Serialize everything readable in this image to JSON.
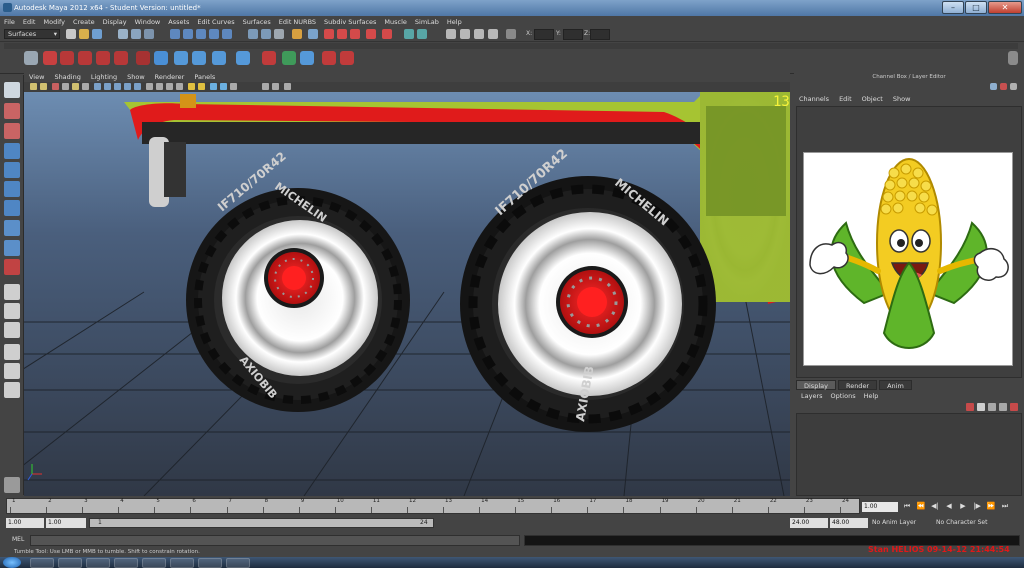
{
  "window": {
    "title": "Autodesk Maya 2012 x64 - Student Version: untitled*",
    "minimize": "–",
    "maximize": "□",
    "close": "✕"
  },
  "menubar": [
    "File",
    "Edit",
    "Modify",
    "Create",
    "Display",
    "Window",
    "Assets",
    "Edit Curves",
    "Surfaces",
    "Edit NURBS",
    "Subdiv Surfaces",
    "Muscle",
    "SimLab",
    "Help"
  ],
  "statusline": {
    "mode": "Surfaces",
    "x_label": "X:",
    "y_label": "Y:",
    "z_label": "Z:"
  },
  "viewport": {
    "menu": [
      "View",
      "Shading",
      "Lighting",
      "Show",
      "Renderer",
      "Panels"
    ],
    "frame_counter": "13"
  },
  "channel_box": {
    "header": "Channel Box / Layer Editor",
    "menu": [
      "Channels",
      "Edit",
      "Object",
      "Show"
    ]
  },
  "layer_editor": {
    "tabs": [
      "Display",
      "Render",
      "Anim"
    ],
    "active_tab": "Display",
    "menu": [
      "Layers",
      "Options",
      "Help"
    ]
  },
  "time_slider": {
    "ticks": [
      "1",
      "2",
      "3",
      "4",
      "5",
      "6",
      "7",
      "8",
      "9",
      "10",
      "11",
      "12",
      "13",
      "14",
      "15",
      "16",
      "17",
      "18",
      "19",
      "20",
      "21",
      "22",
      "23",
      "24"
    ],
    "current_frame": "1.00",
    "playback": [
      "⏮",
      "⏪",
      "◀|",
      "◀",
      "▶",
      "|▶",
      "⏩",
      "⏭"
    ]
  },
  "range_slider": {
    "start": "1.00",
    "start_inner": "1.00",
    "range_start": "1",
    "range_end": "24",
    "end_inner": "24.00",
    "end": "48.00",
    "anim_layer": "No Anim Layer",
    "character_set": "No Character Set"
  },
  "command_line": {
    "label": "MEL"
  },
  "help_line": "Tumble Tool: Use LMB or MMB to tumble. Shift to constrain rotation.",
  "watermark": "Stan HELIOS 09-14-12 21:44:54",
  "tire_text": {
    "size": "IF710/70R42",
    "brand": "MICHELIN",
    "model": "AXIOBIB"
  }
}
